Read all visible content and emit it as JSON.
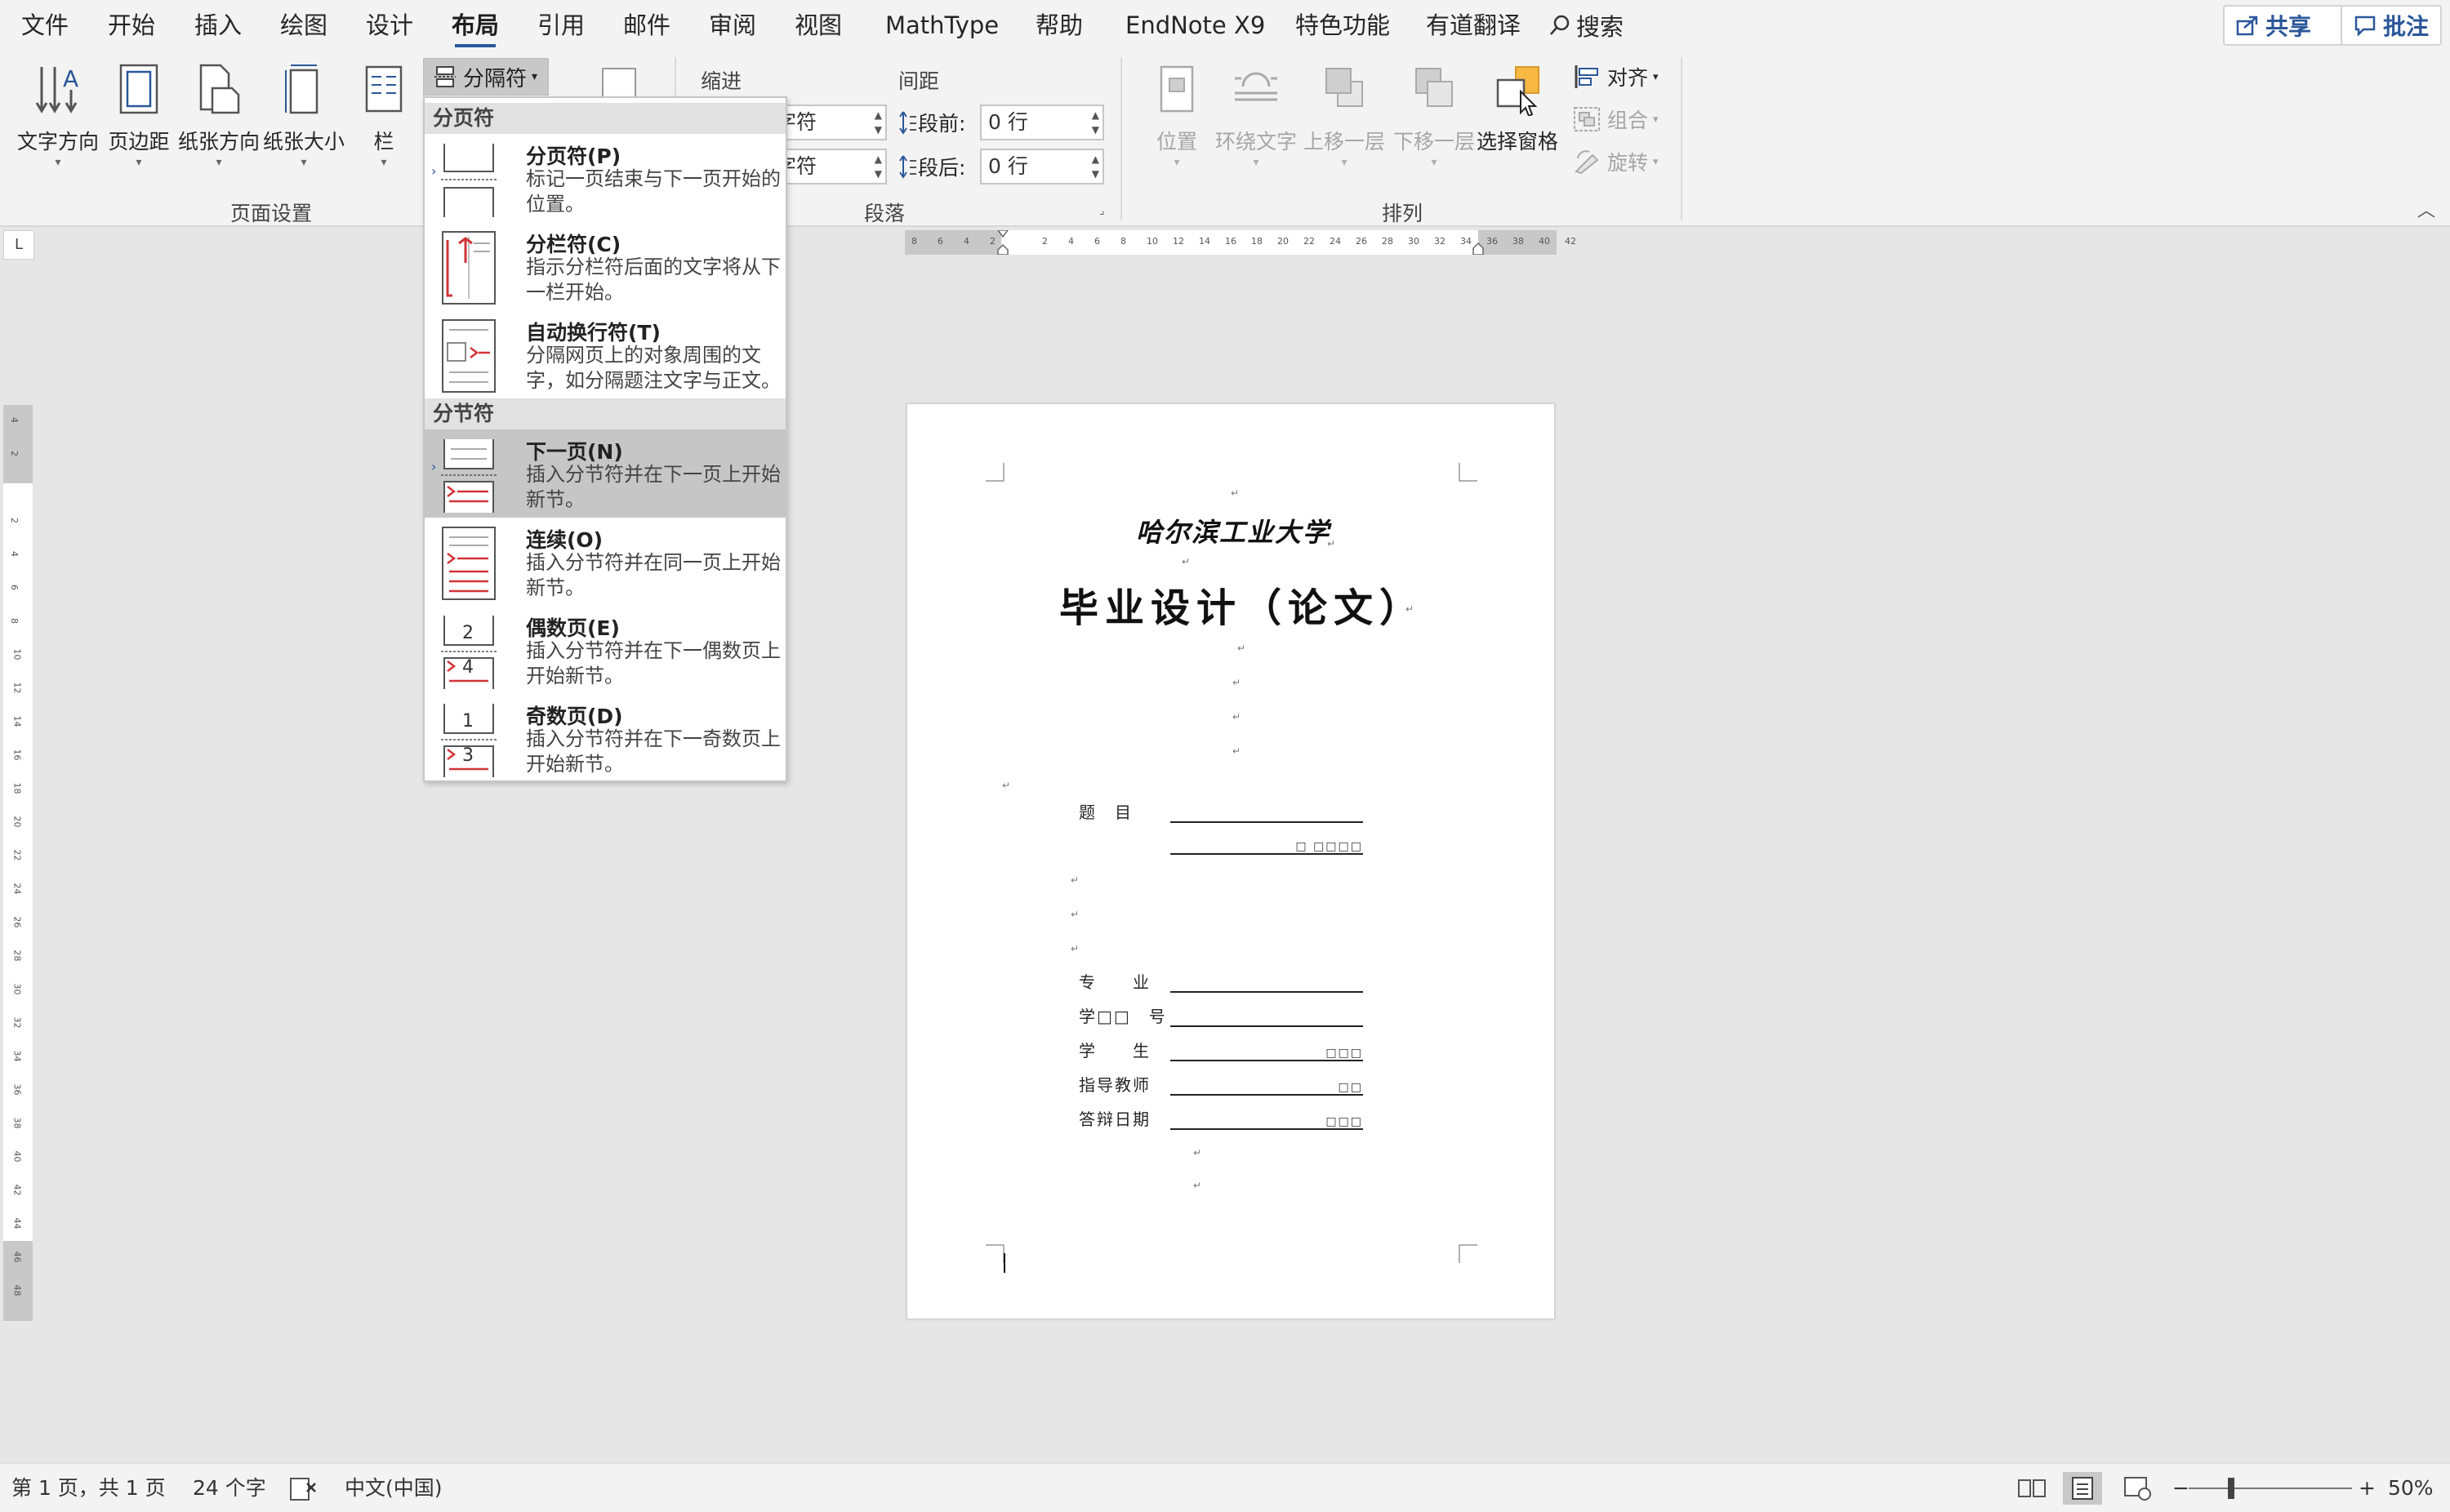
{
  "menu": {
    "tabs": [
      {
        "label": "文件",
        "active": false
      },
      {
        "label": "开始",
        "active": false
      },
      {
        "label": "插入",
        "active": false
      },
      {
        "label": "绘图",
        "active": false
      },
      {
        "label": "设计",
        "active": false
      },
      {
        "label": "布局",
        "active": true
      },
      {
        "label": "引用",
        "active": false
      },
      {
        "label": "邮件",
        "active": false
      },
      {
        "label": "审阅",
        "active": false
      },
      {
        "label": "视图",
        "active": false
      },
      {
        "label": "MathType",
        "active": false
      },
      {
        "label": "帮助",
        "active": false
      },
      {
        "label": "EndNote X9",
        "active": false
      },
      {
        "label": "特色功能",
        "active": false
      },
      {
        "label": "有道翻译",
        "active": false
      }
    ],
    "search_label": "搜索",
    "share_label": "共享",
    "comments_label": "批注"
  },
  "ribbon": {
    "page_setup": {
      "text_direction": "文字方向",
      "margins": "页边距",
      "orientation": "纸张方向",
      "size": "纸张大小",
      "columns": "栏",
      "breaks": "分隔符",
      "group_label": "页面设置"
    },
    "paragraph": {
      "indent_label": "缩进",
      "spacing_label": "间距",
      "indent_left_value": "字符",
      "indent_right_value": "字符",
      "before_label": "段前:",
      "before_value": "0 行",
      "after_label": "段后:",
      "after_value": "0 行",
      "group_label": "段落"
    },
    "arrange": {
      "position": "位置",
      "wrap_text": "环绕文字",
      "bring_forward": "上移一层",
      "send_backward": "下移一层",
      "selection_pane": "选择窗格",
      "align": "对齐",
      "group": "组合",
      "rotate": "旋转",
      "group_label": "排列"
    }
  },
  "breaks_menu": {
    "page_breaks_header": "分页符",
    "section_breaks_header": "分节符",
    "items": [
      {
        "title": "分页符(P)",
        "desc": "标记一页结束与下一页开始的位置。"
      },
      {
        "title": "分栏符(C)",
        "desc": "指示分栏符后面的文字将从下一栏开始。"
      },
      {
        "title": "自动换行符(T)",
        "desc": "分隔网页上的对象周围的文字，如分隔题注文字与正文。"
      },
      {
        "title": "下一页(N)",
        "desc": "插入分节符并在下一页上开始新节。",
        "highlighted": true
      },
      {
        "title": "连续(O)",
        "desc": "插入分节符并在同一页上开始新节。"
      },
      {
        "title": "偶数页(E)",
        "desc": "插入分节符并在下一偶数页上开始新节。"
      },
      {
        "title": "奇数页(D)",
        "desc": "插入分节符并在下一奇数页上开始新节。"
      }
    ],
    "icon_numbers": {
      "even_top": "2",
      "even_bottom": "4",
      "odd_top": "1",
      "odd_bottom": "3"
    }
  },
  "ruler": {
    "horizontal_ticks": [
      "8",
      "6",
      "4",
      "2",
      "",
      "2",
      "4",
      "6",
      "8",
      "10",
      "12",
      "14",
      "16",
      "18",
      "20",
      "22",
      "24",
      "26",
      "28",
      "30",
      "32",
      "34",
      "36",
      "38",
      "40",
      "42"
    ],
    "vertical_ticks": [
      "4",
      "2",
      "",
      "2",
      "4",
      "6",
      "8",
      "10",
      "12",
      "14",
      "16",
      "18",
      "20",
      "22",
      "24",
      "26",
      "28",
      "30",
      "32",
      "34",
      "36",
      "38",
      "40",
      "42",
      "44",
      "46",
      "48"
    ],
    "tab_selector": "L"
  },
  "document": {
    "university": "哈尔滨工业大学",
    "title": "毕业设计（论文）",
    "fields": [
      {
        "label": "题　目",
        "value": ""
      },
      {
        "label": "",
        "value": "□ □□□□"
      },
      {
        "label": "专　　业",
        "value": ""
      },
      {
        "label": "学□□　号",
        "value": ""
      },
      {
        "label": "学　　生",
        "value": "□□□"
      },
      {
        "label": "指导教师",
        "value": "□□"
      },
      {
        "label": "答辩日期",
        "value": "□□□"
      }
    ],
    "para_mark": "↵"
  },
  "status": {
    "page_info": "第 1 页，共 1 页",
    "word_count": "24 个字",
    "language": "中文(中国)",
    "zoom": "50%",
    "zoom_fraction": 0.25
  },
  "colors": {
    "accent": "#2b579a",
    "ribbon_bg": "#f3f3f3",
    "canvas_bg": "#e6e6e6",
    "highlight": "#c6c6c6",
    "red_icon": "#d13438",
    "selection_orange": "#f7b844"
  }
}
